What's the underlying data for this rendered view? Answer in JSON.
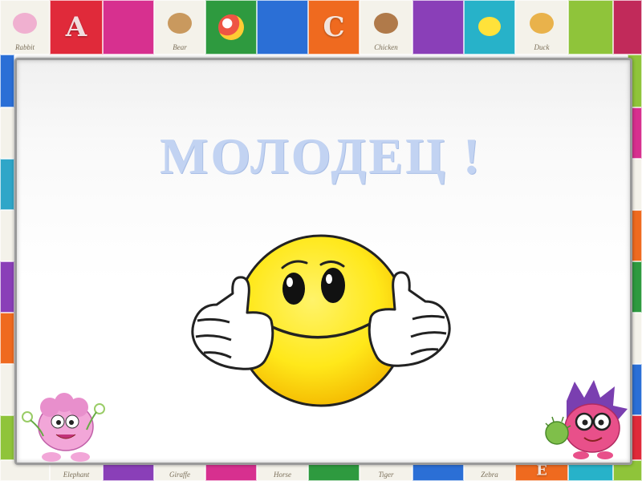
{
  "slide": {
    "title": "МОЛОДЕЦ !"
  },
  "border": {
    "letters": [
      "A",
      "C",
      "E"
    ],
    "captions": [
      "Rabbit",
      "Bear",
      "Chicken",
      "Duck",
      "Elephant",
      "Giraffe",
      "Horse",
      "Tiger",
      "Zebra"
    ]
  },
  "icons": {
    "smiley": "thumbs-up-smiley-icon",
    "left_character": "pink-ram-character-icon",
    "right_character": "purple-hedgehog-character-icon"
  },
  "colors": {
    "title": "#c2d3f2",
    "smiley_face": "#ffe81a",
    "panel_border": "#9a9a9a"
  }
}
